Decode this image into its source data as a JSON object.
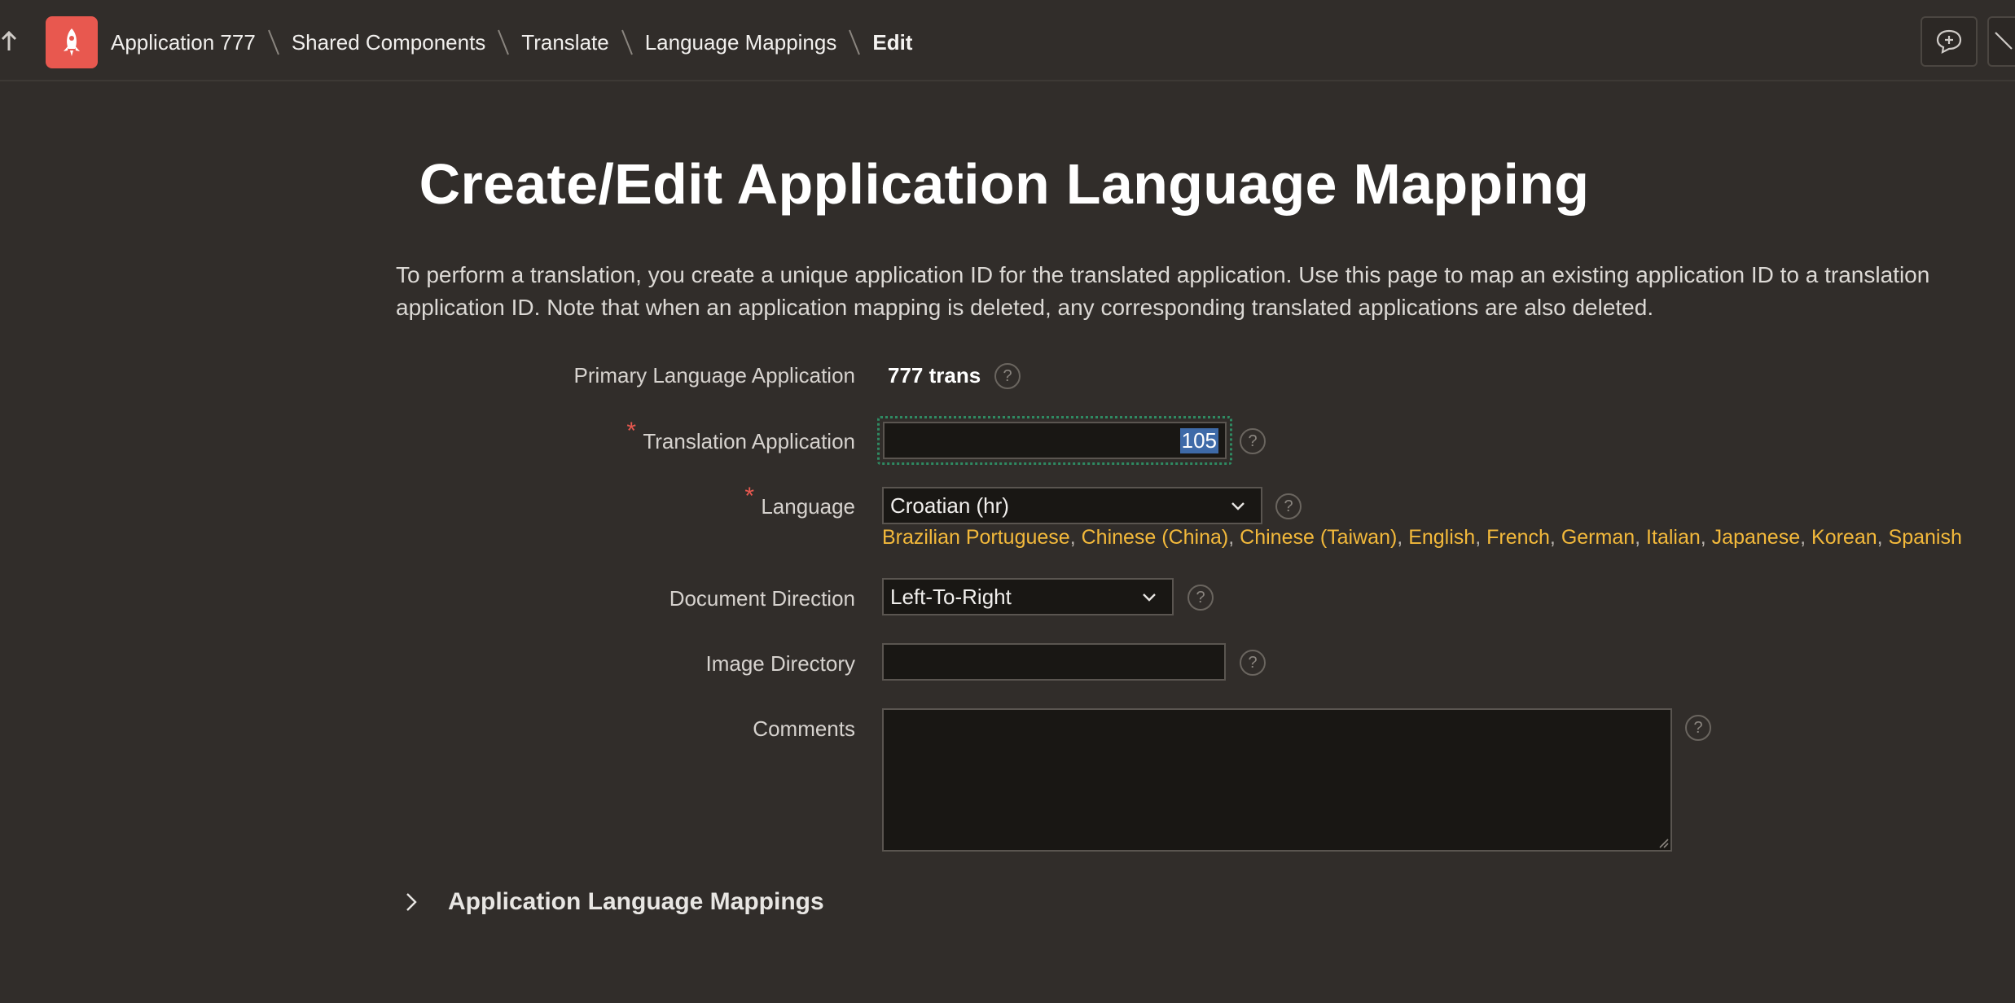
{
  "breadcrumb": {
    "items": [
      "Application 777",
      "Shared Components",
      "Translate",
      "Language Mappings"
    ],
    "current": "Edit"
  },
  "page": {
    "title": "Create/Edit Application Language Mapping",
    "description": "To perform a translation, you create a unique application ID for the translated application. Use this page to map an existing application ID to a translation application ID. Note that when an application mapping is deleted, any corresponding translated applications are also deleted."
  },
  "form": {
    "primary_label": "Primary Language Application",
    "primary_value": "777 trans",
    "translation_label": "Translation Application",
    "translation_value": "105",
    "language_label": "Language",
    "language_value": "Croatian (hr)",
    "language_shortcuts": [
      "Brazilian Portuguese",
      "Chinese (China)",
      "Chinese (Taiwan)",
      "English",
      "French",
      "German",
      "Italian",
      "Japanese",
      "Korean",
      "Spanish"
    ],
    "direction_label": "Document Direction",
    "direction_value": "Left-To-Right",
    "image_dir_label": "Image Directory",
    "image_dir_value": "",
    "comments_label": "Comments",
    "comments_value": "",
    "required_mark": "*",
    "help_glyph": "?"
  },
  "section": {
    "title": "Application Language Mappings"
  },
  "icons": {
    "up": "arrow-up-icon",
    "app": "rocket-icon",
    "feedback": "feedback-icon",
    "edit": "pencil-icon"
  },
  "colors": {
    "background": "#312d2a",
    "app_icon": "#e8584f",
    "link": "#f3b93b",
    "required": "#e8584f",
    "focus": "#2f8a62"
  }
}
